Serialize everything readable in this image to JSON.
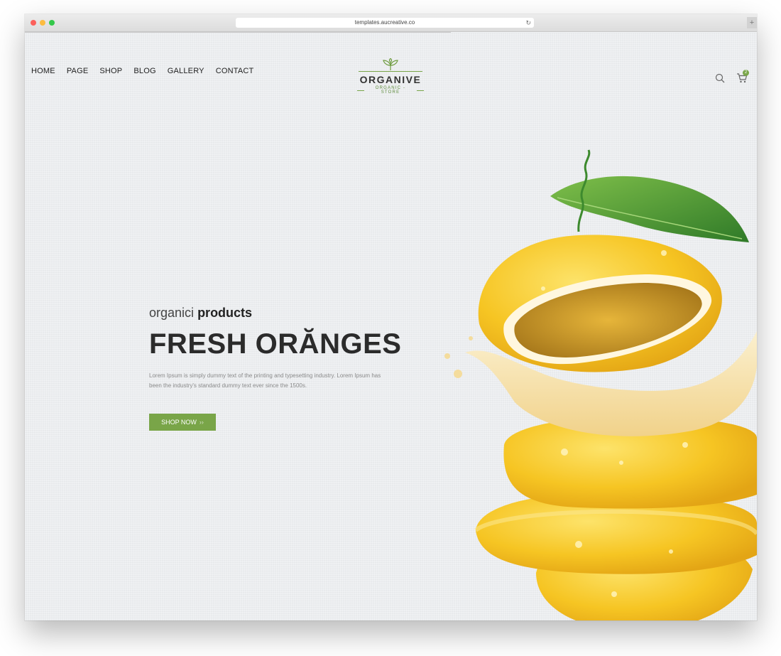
{
  "browser": {
    "url": "templates.aucreative.co",
    "reload_icon": "reload-icon",
    "newtab_label": "+"
  },
  "nav": {
    "items": [
      "HOME",
      "PAGE",
      "SHOP",
      "BLOG",
      "GALLERY",
      "CONTACT"
    ]
  },
  "logo": {
    "name": "ORGANIVE",
    "tagline": "ORGANIC - STORE",
    "icon": "leaf-icon"
  },
  "header_icons": {
    "search": "search-icon",
    "cart": "cart-icon",
    "cart_count": "2"
  },
  "hero": {
    "eyebrow_light": "organici",
    "eyebrow_bold": "products",
    "title": "FRESH ORĂNGES",
    "body": "Lorem Ipsum is simply dummy text of the printing and typesetting industry. Lorem Ipsum has been the industry's standard dummy text ever since the 1500s.",
    "cta_label": "SHOP NOW",
    "cta_arrows": "››"
  },
  "colors": {
    "accent": "#79a548",
    "title": "#2b2b2b",
    "fruit": "#f5c627"
  }
}
